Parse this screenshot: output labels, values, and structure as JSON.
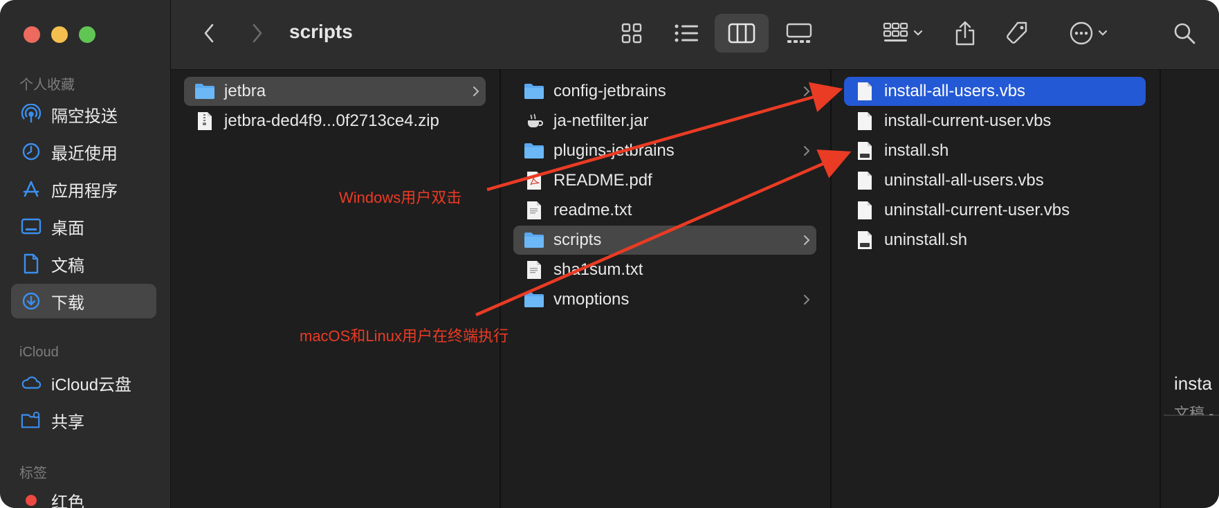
{
  "window": {
    "title": "scripts"
  },
  "sidebar": {
    "sections": [
      {
        "label": "个人收藏",
        "items": [
          {
            "label": "隔空投送",
            "icon": "airdrop-icon"
          },
          {
            "label": "最近使用",
            "icon": "clock-icon"
          },
          {
            "label": "应用程序",
            "icon": "applications-icon"
          },
          {
            "label": "桌面",
            "icon": "desktop-icon"
          },
          {
            "label": "文稿",
            "icon": "document-icon"
          },
          {
            "label": "下载",
            "icon": "download-icon",
            "selected": true
          }
        ]
      },
      {
        "label": "iCloud",
        "items": [
          {
            "label": "iCloud云盘",
            "icon": "cloud-icon"
          },
          {
            "label": "共享",
            "icon": "shared-folder-icon"
          }
        ]
      },
      {
        "label": "标签",
        "items": [
          {
            "label": "红色",
            "icon": "red-tag-icon"
          }
        ]
      }
    ]
  },
  "columns": [
    {
      "items": [
        {
          "name": "jetbra",
          "type": "folder",
          "selected": true,
          "highlight": "gray"
        },
        {
          "name": "jetbra-ded4f9...0f2713ce4.zip",
          "type": "zip"
        }
      ]
    },
    {
      "items": [
        {
          "name": "config-jetbrains",
          "type": "folder"
        },
        {
          "name": "ja-netfilter.jar",
          "type": "jar"
        },
        {
          "name": "plugins-jetbrains",
          "type": "folder"
        },
        {
          "name": "README.pdf",
          "type": "pdf"
        },
        {
          "name": "readme.txt",
          "type": "txt"
        },
        {
          "name": "scripts",
          "type": "folder",
          "selected": true,
          "highlight": "gray"
        },
        {
          "name": "sha1sum.txt",
          "type": "txt"
        },
        {
          "name": "vmoptions",
          "type": "folder"
        }
      ]
    },
    {
      "items": [
        {
          "name": "install-all-users.vbs",
          "type": "file",
          "selected": true,
          "highlight": "blue"
        },
        {
          "name": "install-current-user.vbs",
          "type": "file"
        },
        {
          "name": "install.sh",
          "type": "script"
        },
        {
          "name": "uninstall-all-users.vbs",
          "type": "file"
        },
        {
          "name": "uninstall-current-user.vbs",
          "type": "file"
        },
        {
          "name": "uninstall.sh",
          "type": "script"
        }
      ]
    }
  ],
  "preview": {
    "title": "insta",
    "subtitle": "文稿 -"
  },
  "annotations": [
    {
      "text": "Windows用户双击"
    },
    {
      "text": "macOS和Linux用户在终端执行"
    }
  ],
  "colors": {
    "accent": "#2459d5",
    "annotation": "#ea3b24",
    "folder": "#5aa9f0"
  }
}
